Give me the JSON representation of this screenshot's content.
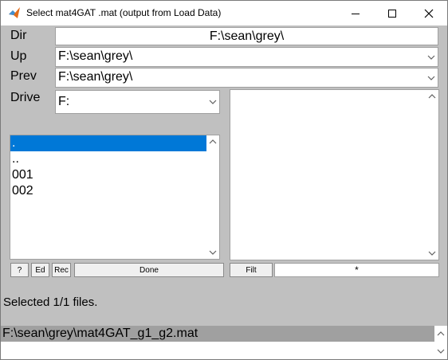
{
  "window": {
    "title": "Select mat4GAT .mat (output from Load Data)"
  },
  "dir": {
    "label": "Dir",
    "value": "F:\\sean\\grey\\"
  },
  "up": {
    "label": "Up",
    "value": "F:\\sean\\grey\\"
  },
  "prev": {
    "label": "Prev",
    "value": "F:\\sean\\grey\\"
  },
  "drive": {
    "label": "Drive",
    "value": "F:"
  },
  "dir_list": {
    "items": [
      ".",
      "..",
      "001",
      "002"
    ],
    "selected_index": 0
  },
  "buttons": {
    "help": "?",
    "edit": "Ed",
    "rec": "Rec",
    "done": "Done",
    "filt": "Filt"
  },
  "filter": {
    "value": "*"
  },
  "status": {
    "text": "Selected 1/1 files."
  },
  "selected_files": [
    "F:\\sean\\grey\\mat4GAT_g1_g2.mat"
  ]
}
